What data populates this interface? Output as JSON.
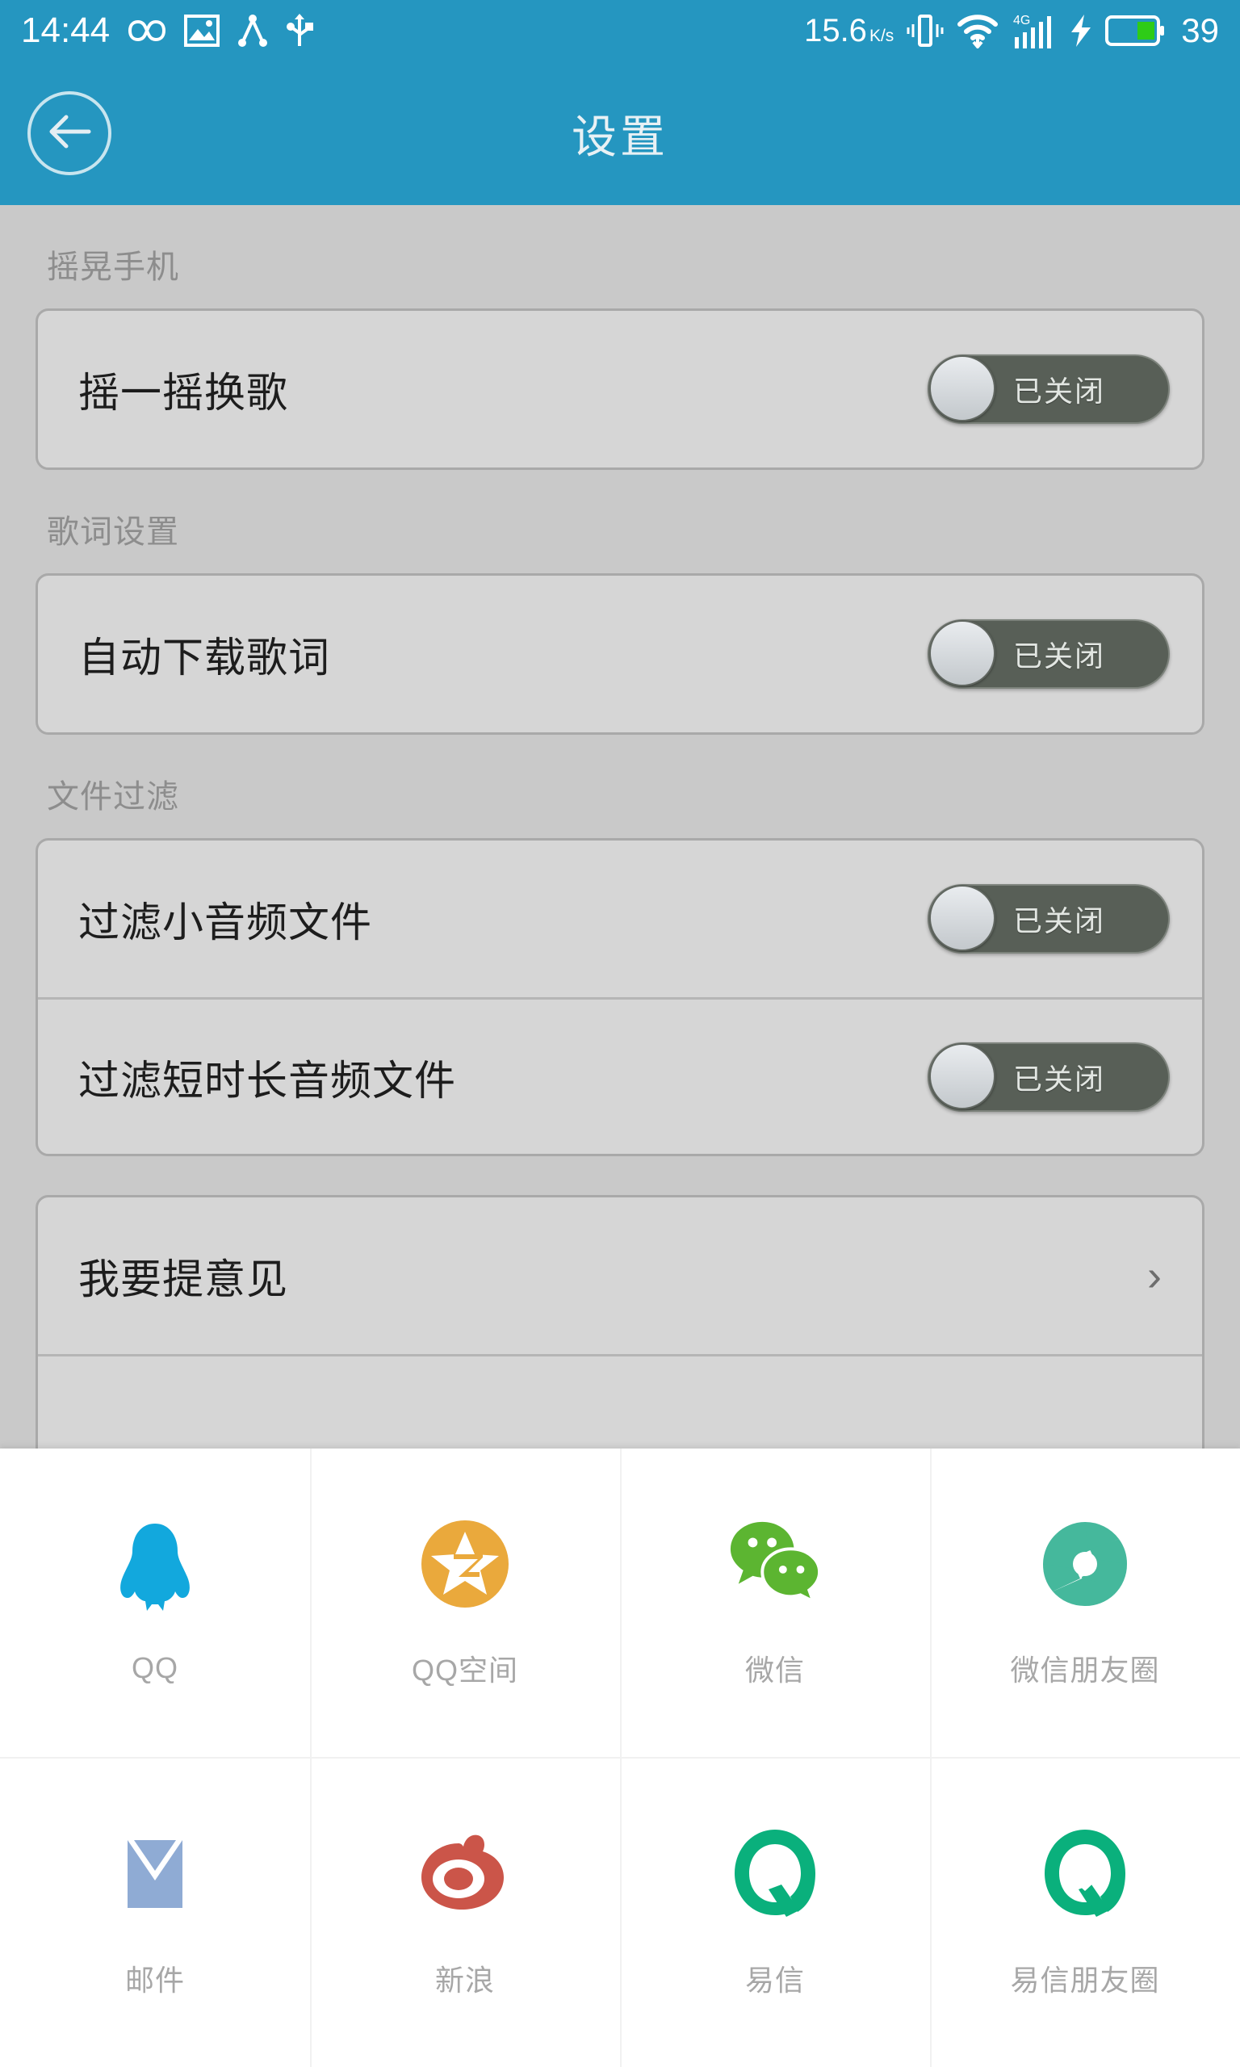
{
  "status_bar": {
    "time": "14:44",
    "net_speed": "15.6",
    "net_speed_unit": "K/s",
    "battery_percent": "39",
    "signal_label": "4G",
    "icons": [
      "infinity-icon",
      "image-icon",
      "bluetooth-share-icon",
      "usb-icon",
      "vibrate-icon",
      "wifi-icon",
      "signal-bars-icon",
      "charging-bolt-icon",
      "battery-icon"
    ]
  },
  "header": {
    "title": "设置",
    "back_icon": "back-arrow-icon"
  },
  "settings": {
    "sections": [
      {
        "label": "摇晃手机",
        "rows": [
          {
            "label": "摇一摇换歌",
            "type": "toggle",
            "state_text": "已关闭",
            "on": false
          }
        ]
      },
      {
        "label": "歌词设置",
        "rows": [
          {
            "label": "自动下载歌词",
            "type": "toggle",
            "state_text": "已关闭",
            "on": false
          }
        ]
      },
      {
        "label": "文件过滤",
        "rows": [
          {
            "label": "过滤小音频文件",
            "type": "toggle",
            "state_text": "已关闭",
            "on": false
          },
          {
            "label": "过滤短时长音频文件",
            "type": "toggle",
            "state_text": "已关闭",
            "on": false
          }
        ]
      },
      {
        "label": "",
        "rows": [
          {
            "label": "我要提意见",
            "type": "link",
            "chevron": "›"
          }
        ]
      }
    ]
  },
  "share_sheet": {
    "rows": [
      [
        {
          "label": "QQ",
          "icon": "qq-penguin-icon",
          "color": "#12a8dd"
        },
        {
          "label": "QQ空间",
          "icon": "qzone-star-icon",
          "color": "#eaa93c"
        },
        {
          "label": "微信",
          "icon": "wechat-bubbles-icon",
          "color": "#5cb531"
        },
        {
          "label": "微信朋友圈",
          "icon": "wechat-moments-aperture-icon",
          "color": "#45b89c"
        }
      ],
      [
        {
          "label": "邮件",
          "icon": "mail-envelope-icon",
          "color": "#8fabd4"
        },
        {
          "label": "新浪",
          "icon": "sina-weibo-eye-icon",
          "color": "#cb5549"
        },
        {
          "label": "易信",
          "icon": "yixin-q-icon",
          "color": "#0ab07c"
        },
        {
          "label": "易信朋友圈",
          "icon": "yixin-moments-heart-icon",
          "color": "#0ab07c"
        }
      ]
    ]
  },
  "colors": {
    "accent": "#2596c0",
    "page_bg": "#c9c9c9",
    "card_bg": "#d6d6d6",
    "toggle_off_track": "#585f57"
  }
}
